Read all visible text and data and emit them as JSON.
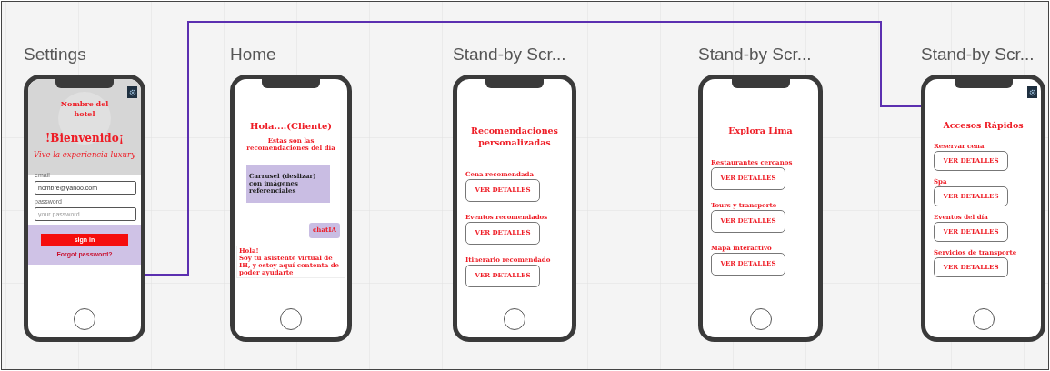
{
  "frames": [
    {
      "title": "Settings",
      "kind": "login",
      "settings_button": true,
      "hotel_name": "Nombre del hotel",
      "greeting": "!Bienvenido¡",
      "tagline": "Vive la experiencia luxury",
      "fields": [
        {
          "label": "email",
          "value": "nombre@yahoo.com"
        },
        {
          "label": "password",
          "placeholder": "your password"
        }
      ],
      "submit": "sign in",
      "link": "Forgot password?"
    },
    {
      "title": "Home",
      "kind": "home",
      "settings_button": false,
      "heading": "Hola....(Cliente)",
      "subheading": "Estas son las recomendaciones del día",
      "carousel": "Carrusel (deslizar) con imágenes referenciales",
      "chat_button": "chatIA",
      "message_title": "Hola!",
      "message": "Soy tu asistente virtual de IH, y estoy aquí contenta de poder ayudarte"
    },
    {
      "title": "Stand-by Scr...",
      "kind": "list",
      "settings_button": false,
      "heading": "Recomendaciones personalizadas",
      "items": [
        {
          "label": "Cena recomendada",
          "button": "VER DETALLES"
        },
        {
          "label": "Eventos recomendados",
          "button": "VER DETALLES"
        },
        {
          "label": "Itinerario recomendado",
          "button": "VER DETALLES"
        }
      ]
    },
    {
      "title": "Stand-by Scr...",
      "kind": "list",
      "settings_button": false,
      "heading": "Explora Lima",
      "items": [
        {
          "label": "Restaurantes cercanos",
          "button": "VER DETALLES"
        },
        {
          "label": "Tours y transporte",
          "button": "VER DETALLES"
        },
        {
          "label": "Mapa interactivo",
          "button": "VER DETALLES"
        }
      ]
    },
    {
      "title": "Stand-by Scr...",
      "kind": "list",
      "settings_button": true,
      "heading": "Accesos Rápidos",
      "items": [
        {
          "label": "Reservar cena",
          "button": "VER DETALLES"
        },
        {
          "label": "Spa",
          "button": "VER DETALLES"
        },
        {
          "label": "Eventos del día",
          "button": "VER DETALLES"
        },
        {
          "label": "Servicios de transporte",
          "button": "VER DETALLES"
        }
      ]
    }
  ]
}
